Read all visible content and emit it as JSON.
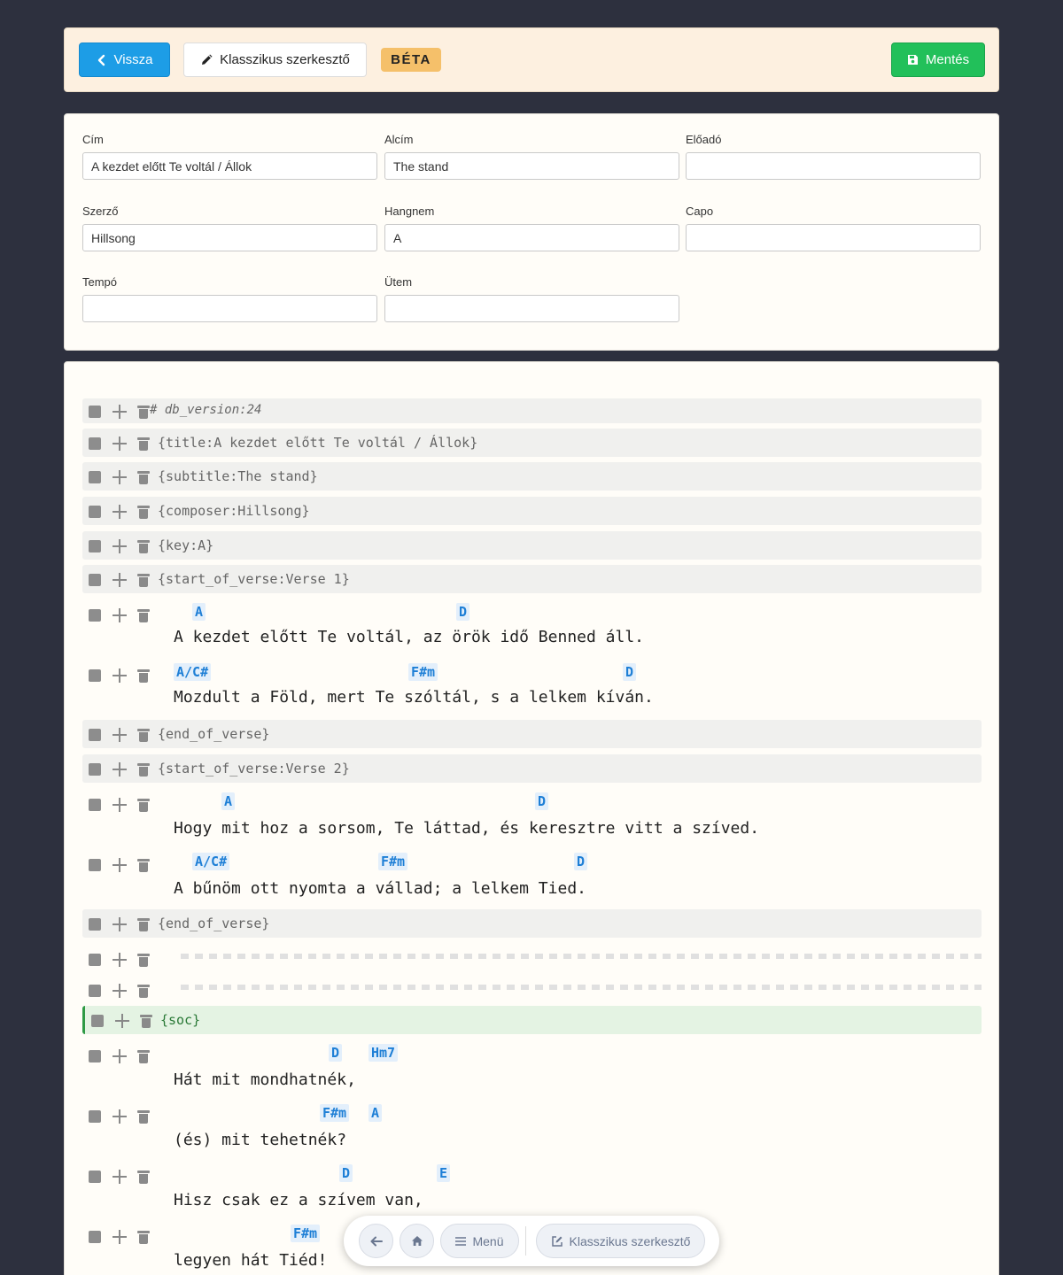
{
  "toolbar": {
    "back_label": "Vissza",
    "classic_label": "Klasszikus szerkesztő",
    "beta_label": "BÉTA",
    "save_label": "Mentés"
  },
  "meta": {
    "title": {
      "label": "Cím",
      "value": "A kezdet előtt Te voltál / Állok"
    },
    "subtitle": {
      "label": "Alcím",
      "value": "The stand"
    },
    "artist": {
      "label": "Előadó",
      "value": ""
    },
    "composer": {
      "label": "Szerző",
      "value": "Hillsong"
    },
    "key": {
      "label": "Hangnem",
      "value": "A"
    },
    "capo": {
      "label": "Capo",
      "value": ""
    },
    "tempo": {
      "label": "Tempó",
      "value": ""
    },
    "time": {
      "label": "Ütem",
      "value": ""
    }
  },
  "editor": {
    "d0": "# db_version:24",
    "d1": "{title:A kezdet előtt Te voltál / Állok}",
    "d2": "{subtitle:The stand}",
    "d3": "{composer:Hillsong}",
    "d4": "{key:A}",
    "d5": "{start_of_verse:Verse 1}",
    "l1": {
      "text": "A kezdet előtt Te voltál, az örök idő Benned áll.",
      "c1": "A",
      "c2": "D"
    },
    "l2": {
      "text": "Mozdult a Föld, mert Te szóltál, s a lelkem kíván.",
      "c1": "A/C#",
      "c2": "F#m",
      "c3": "D"
    },
    "d6": "{end_of_verse}",
    "d7": "{start_of_verse:Verse 2}",
    "l3": {
      "text": "Hogy mit hoz a sorsom, Te láttad, és keresztre vitt a szíved.",
      "c1": "A",
      "c2": "D"
    },
    "l4": {
      "text": "A bűnöm ott nyomta a vállad; a lelkem Tied.",
      "c1": "A/C#",
      "c2": "F#m",
      "c3": "D"
    },
    "d8": "{end_of_verse}",
    "d9": "{soc}",
    "l5": {
      "text": "Hát mit mondhatnék,",
      "c1": "D",
      "c2": "Hm7"
    },
    "l6": {
      "text": "(és) mit tehetnék?",
      "c1": "F#m",
      "c2": "A"
    },
    "l7": {
      "text": "Hisz csak ez a szívem van,",
      "c1": "D",
      "c2": "E"
    },
    "l8": {
      "text": "legyen hát Tiéd!",
      "c1": "F#m"
    }
  },
  "floatbar": {
    "menu_label": "Menü",
    "classic_label": "Klasszikus szerkesztő"
  },
  "colors": {
    "background": "#2d303e",
    "primary": "#1d9de6",
    "save": "#22c05a",
    "beta": "#f5c06a",
    "chord": "#1e7fd6",
    "soc": "#2e9a45"
  }
}
